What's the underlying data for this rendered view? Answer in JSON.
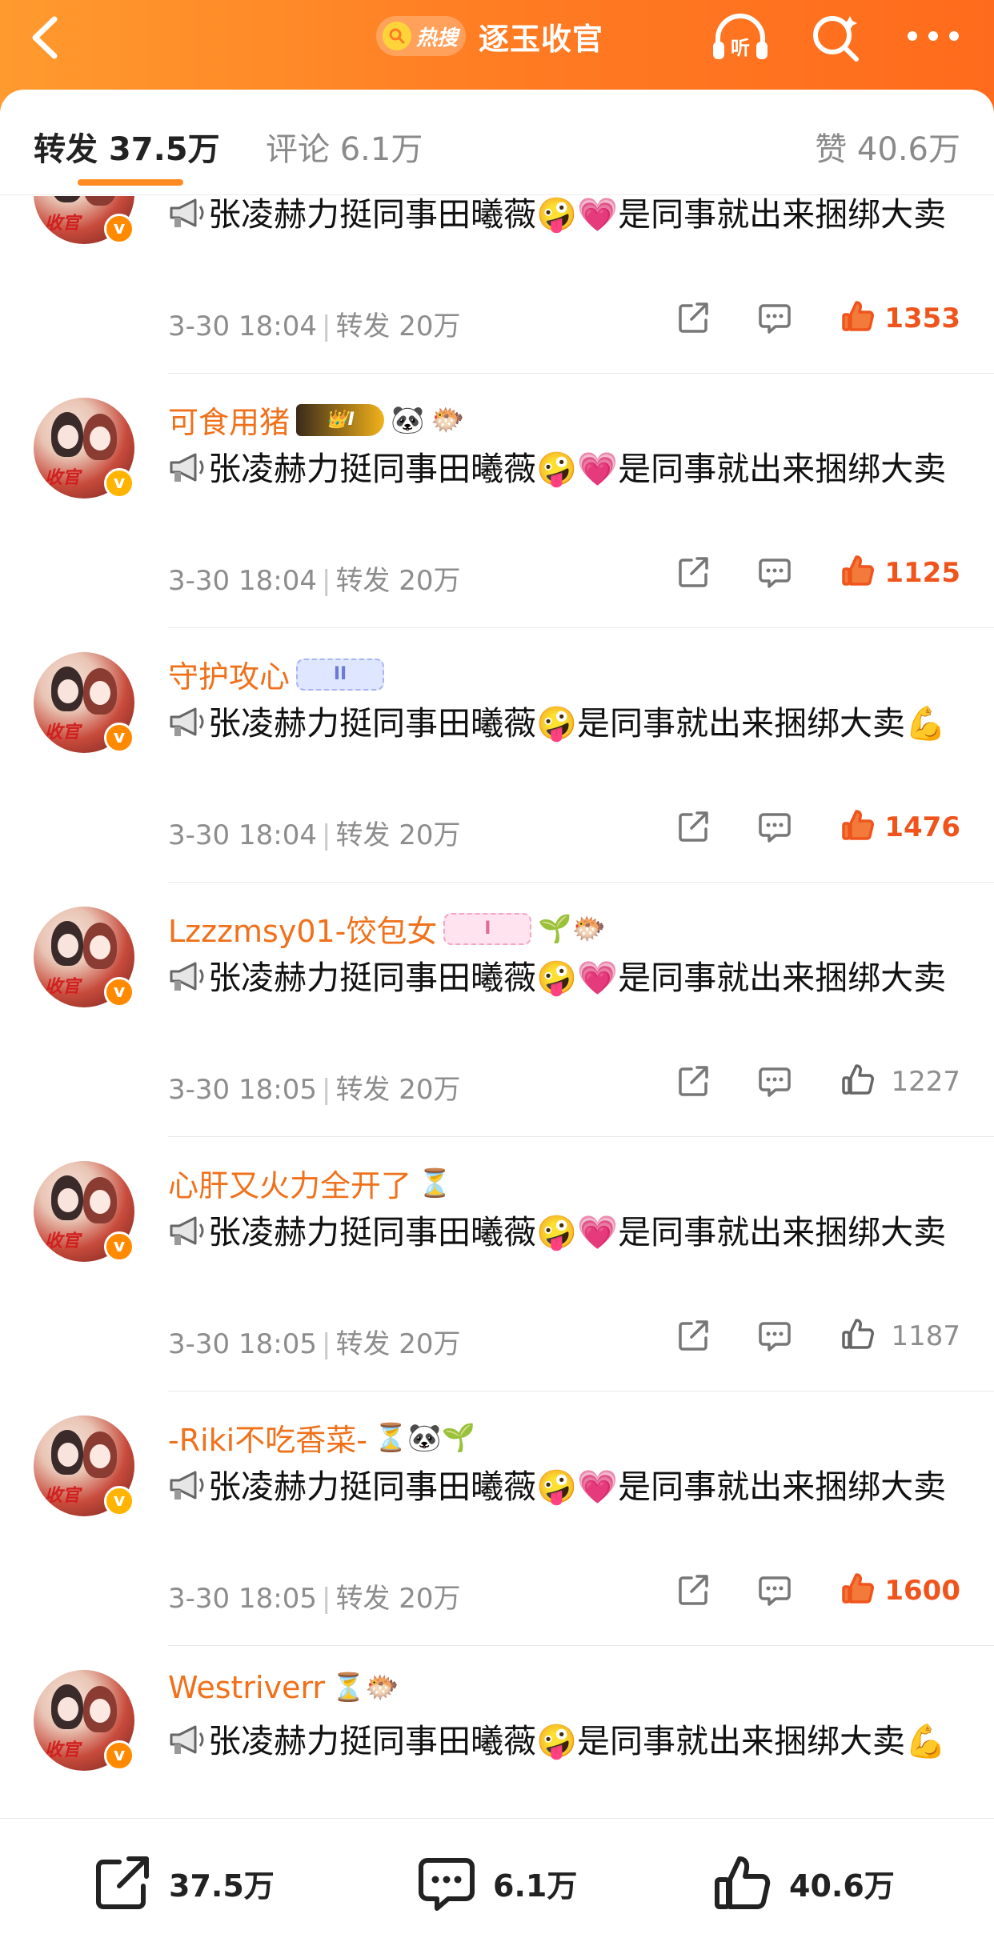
{
  "header": {
    "hot_badge": "热搜",
    "title": "逐玉收官",
    "listen_label": "听"
  },
  "tabs": {
    "repost": "转发 37.5万",
    "comment": "评论 6.1万",
    "like": "赞 40.6万"
  },
  "avatar_caption": "收官",
  "verified_mark": "v",
  "posts": [
    {
      "username": "",
      "text": "张凌赫力挺同事田曦薇🤪💗是同事就出来捆绑大卖",
      "time": "3-30 18:04",
      "repost": "转发 20万",
      "likes": "1353",
      "liked": true
    },
    {
      "username": "可食用猪",
      "badges": [
        "crown",
        "🐼",
        "🐡"
      ],
      "crown_label": "I",
      "text": "张凌赫力挺同事田曦薇🤪💗是同事就出来捆绑大卖",
      "time": "3-30 18:04",
      "repost": "转发 20万",
      "likes": "1125",
      "liked": true
    },
    {
      "username": "守护攻心",
      "level_label": "II",
      "text": "张凌赫力挺同事田曦薇🤪是同事就出来捆绑大卖💪",
      "time": "3-30 18:04",
      "repost": "转发 20万",
      "likes": "1476",
      "liked": true
    },
    {
      "username": "Lzzzmsy01-饺包女",
      "level_label": "I",
      "extra": "🌱🐡",
      "text": "张凌赫力挺同事田曦薇🤪💗是同事就出来捆绑大卖",
      "time": "3-30 18:05",
      "repost": "转发 20万",
      "likes": "1227",
      "liked": false
    },
    {
      "username": "心肝又火力全开了",
      "extra": "⏳",
      "text": "张凌赫力挺同事田曦薇🤪💗是同事就出来捆绑大卖",
      "time": "3-30 18:05",
      "repost": "转发 20万",
      "likes": "1187",
      "liked": false
    },
    {
      "username": "-Riki不吃香菜-",
      "extra": "⏳🐼🌱",
      "text": "张凌赫力挺同事田曦薇🤪💗是同事就出来捆绑大卖",
      "time": "3-30 18:05",
      "repost": "转发 20万",
      "likes": "1600",
      "liked": true
    },
    {
      "username": "Westriverr",
      "extra": "⏳🐡",
      "text": "张凌赫力挺同事田曦薇🤪是同事就出来捆绑大卖💪",
      "time": "",
      "repost": "",
      "likes": "",
      "liked": false
    }
  ],
  "bottom_bar": {
    "repost": "37.5万",
    "comment": "6.1万",
    "like": "40.6万"
  },
  "colors": {
    "accent": "#ff7a22",
    "username": "#f0711b",
    "like_hot": "#f0541d",
    "meta": "#8d8d8d"
  }
}
